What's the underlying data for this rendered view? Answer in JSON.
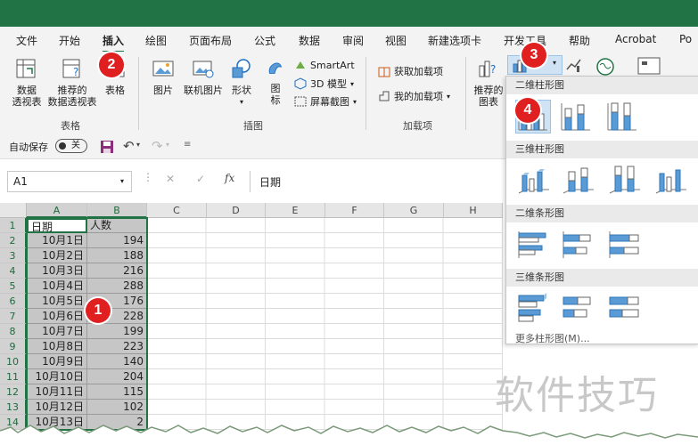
{
  "ribbon_tabs": [
    "文件",
    "开始",
    "插入",
    "绘图",
    "页面布局",
    "公式",
    "数据",
    "审阅",
    "视图",
    "新建选项卡",
    "开发工具",
    "帮助",
    "Acrobat",
    "Po"
  ],
  "active_tab": "插入",
  "groups": {
    "tables": {
      "label": "表格",
      "pivot_label_1": "数据",
      "pivot_label_2": "透视表",
      "recommended_pivot_label_1": "推荐的",
      "recommended_pivot_label_2": "数据透视表",
      "table_label": "表格"
    },
    "illustrations": {
      "label": "插图",
      "pictures_label": "图片",
      "online_pictures_label": "联机图片",
      "shapes_label": "形状",
      "icons_label_1": "图",
      "icons_label_2": "标",
      "smartart_label": "SmartArt",
      "model3d_label": "3D 模型",
      "screenshot_label": "屏幕截图"
    },
    "addins": {
      "label": "加载项",
      "get_addins_label": "获取加载项",
      "my_addins_label": "我的加载项"
    },
    "charts": {
      "recommended_label_1": "推荐的",
      "recommended_label_2": "图表"
    }
  },
  "qat": {
    "autosave_label": "自动保存",
    "autosave_state": "关"
  },
  "formula_bar": {
    "name_box": "A1",
    "fx_label": "fx",
    "formula_value": "日期"
  },
  "sheet": {
    "columns": [
      "A",
      "B",
      "C",
      "D",
      "E",
      "F",
      "G",
      "H"
    ],
    "rows": [
      "1",
      "2",
      "3",
      "4",
      "5",
      "6",
      "7",
      "8",
      "9",
      "10",
      "11",
      "12",
      "13",
      "14"
    ],
    "header": [
      "日期",
      "人数"
    ],
    "data": [
      [
        "10月1日",
        "194"
      ],
      [
        "10月2日",
        "188"
      ],
      [
        "10月3日",
        "216"
      ],
      [
        "10月4日",
        "288"
      ],
      [
        "10月5日",
        "176"
      ],
      [
        "10月6日",
        "228"
      ],
      [
        "10月7日",
        "199"
      ],
      [
        "10月8日",
        "223"
      ],
      [
        "10月9日",
        "140"
      ],
      [
        "10月10日",
        "204"
      ],
      [
        "10月11日",
        "115"
      ],
      [
        "10月12日",
        "102"
      ],
      [
        "10月13日",
        "2"
      ]
    ]
  },
  "chart_menu": {
    "sections": [
      "二维柱形图",
      "三维柱形图",
      "二维条形图",
      "三维条形图"
    ],
    "more_label": "更多柱形图(M)..."
  },
  "badges": [
    "1",
    "2",
    "3",
    "4"
  ],
  "watermark": "软件技巧",
  "colors": {
    "excel_green": "#217346",
    "badge_red": "#e02020",
    "chart_blue": "#5b9bd5",
    "selection_gray": "#c6c6c6"
  },
  "icons": [
    "pivot-table-icon",
    "recommended-pivot-icon",
    "table-icon",
    "picture-icon",
    "online-picture-icon",
    "shapes-icon",
    "icons-icon",
    "smartart-icon",
    "3d-model-icon",
    "screenshot-icon",
    "store-icon",
    "my-addins-icon",
    "recommended-charts-icon",
    "column-chart-icon",
    "chevron-down-icon",
    "save-icon",
    "undo-icon",
    "redo-icon",
    "fx-icon",
    "cancel-icon",
    "enter-icon"
  ]
}
